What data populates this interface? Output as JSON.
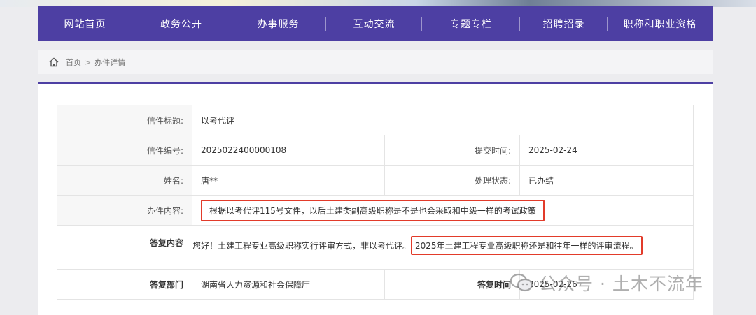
{
  "nav": {
    "items": [
      "网站首页",
      "政务公开",
      "办事服务",
      "互动交流",
      "专题专栏",
      "招聘招录",
      "职称和职业资格"
    ]
  },
  "breadcrumb": {
    "home": "首页",
    "sep": ">",
    "current": "办件详情"
  },
  "letter": {
    "title_label": "信件标题:",
    "title": "以考代评",
    "number_label": "信件编号:",
    "number": "2025022400000108",
    "submit_label": "提交时间:",
    "submit_time": "2025-02-24",
    "name_label": "姓名:",
    "name": "唐**",
    "status_label": "处理状态:",
    "status": "已办结",
    "content_label": "办件内容:",
    "content": "根据以考代评115号文件，以后土建类副高级职称是不是也会采取和中级一样的考试政策",
    "reply_label": "答复内容",
    "reply_part1": "您好！土建工程专业高级职称实行评审方式，非以考代评。",
    "reply_part2": "2025年土建工程专业高级职称还是和往年一样的评审流程。",
    "dept_label": "答复部门",
    "dept": "湖南省人力资源和社会保障厅",
    "reply_time_label": "答复时间",
    "reply_time": "2025-02-26"
  },
  "watermark": {
    "text": "公众号 · 土木不流年"
  },
  "colors": {
    "nav_bg": "#4d3fa3",
    "highlight": "#e23b2a"
  }
}
